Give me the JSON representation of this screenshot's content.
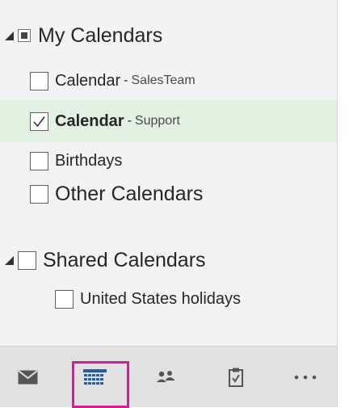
{
  "groups": [
    {
      "title": "My Calendars",
      "state": "partial",
      "items": [
        {
          "name": "Calendar",
          "separator": "-",
          "sub": "SalesTeam",
          "checked": false
        },
        {
          "name": "Calendar",
          "separator": "-",
          "sub": "Support",
          "checked": true,
          "selected": true
        },
        {
          "name": "Birthdays",
          "checked": false
        }
      ]
    },
    {
      "title": "Other Calendars",
      "state": "unchecked"
    },
    {
      "title": "Shared Calendars",
      "state": "unchecked",
      "items": [
        {
          "name": "United States holidays",
          "checked": false
        }
      ]
    }
  ],
  "nav": {
    "items": [
      {
        "icon": "mail-icon"
      },
      {
        "icon": "calendar-icon",
        "active": true
      },
      {
        "icon": "people-icon"
      },
      {
        "icon": "tasks-icon"
      },
      {
        "icon": "more-icon"
      }
    ]
  },
  "colors": {
    "pane_background": "#f3f3f3",
    "selected_row": "#e3f1e3",
    "active_highlight": "#e4159c",
    "calendar_icon": "#1f5fae",
    "nav_background": "#e1e1e1"
  }
}
